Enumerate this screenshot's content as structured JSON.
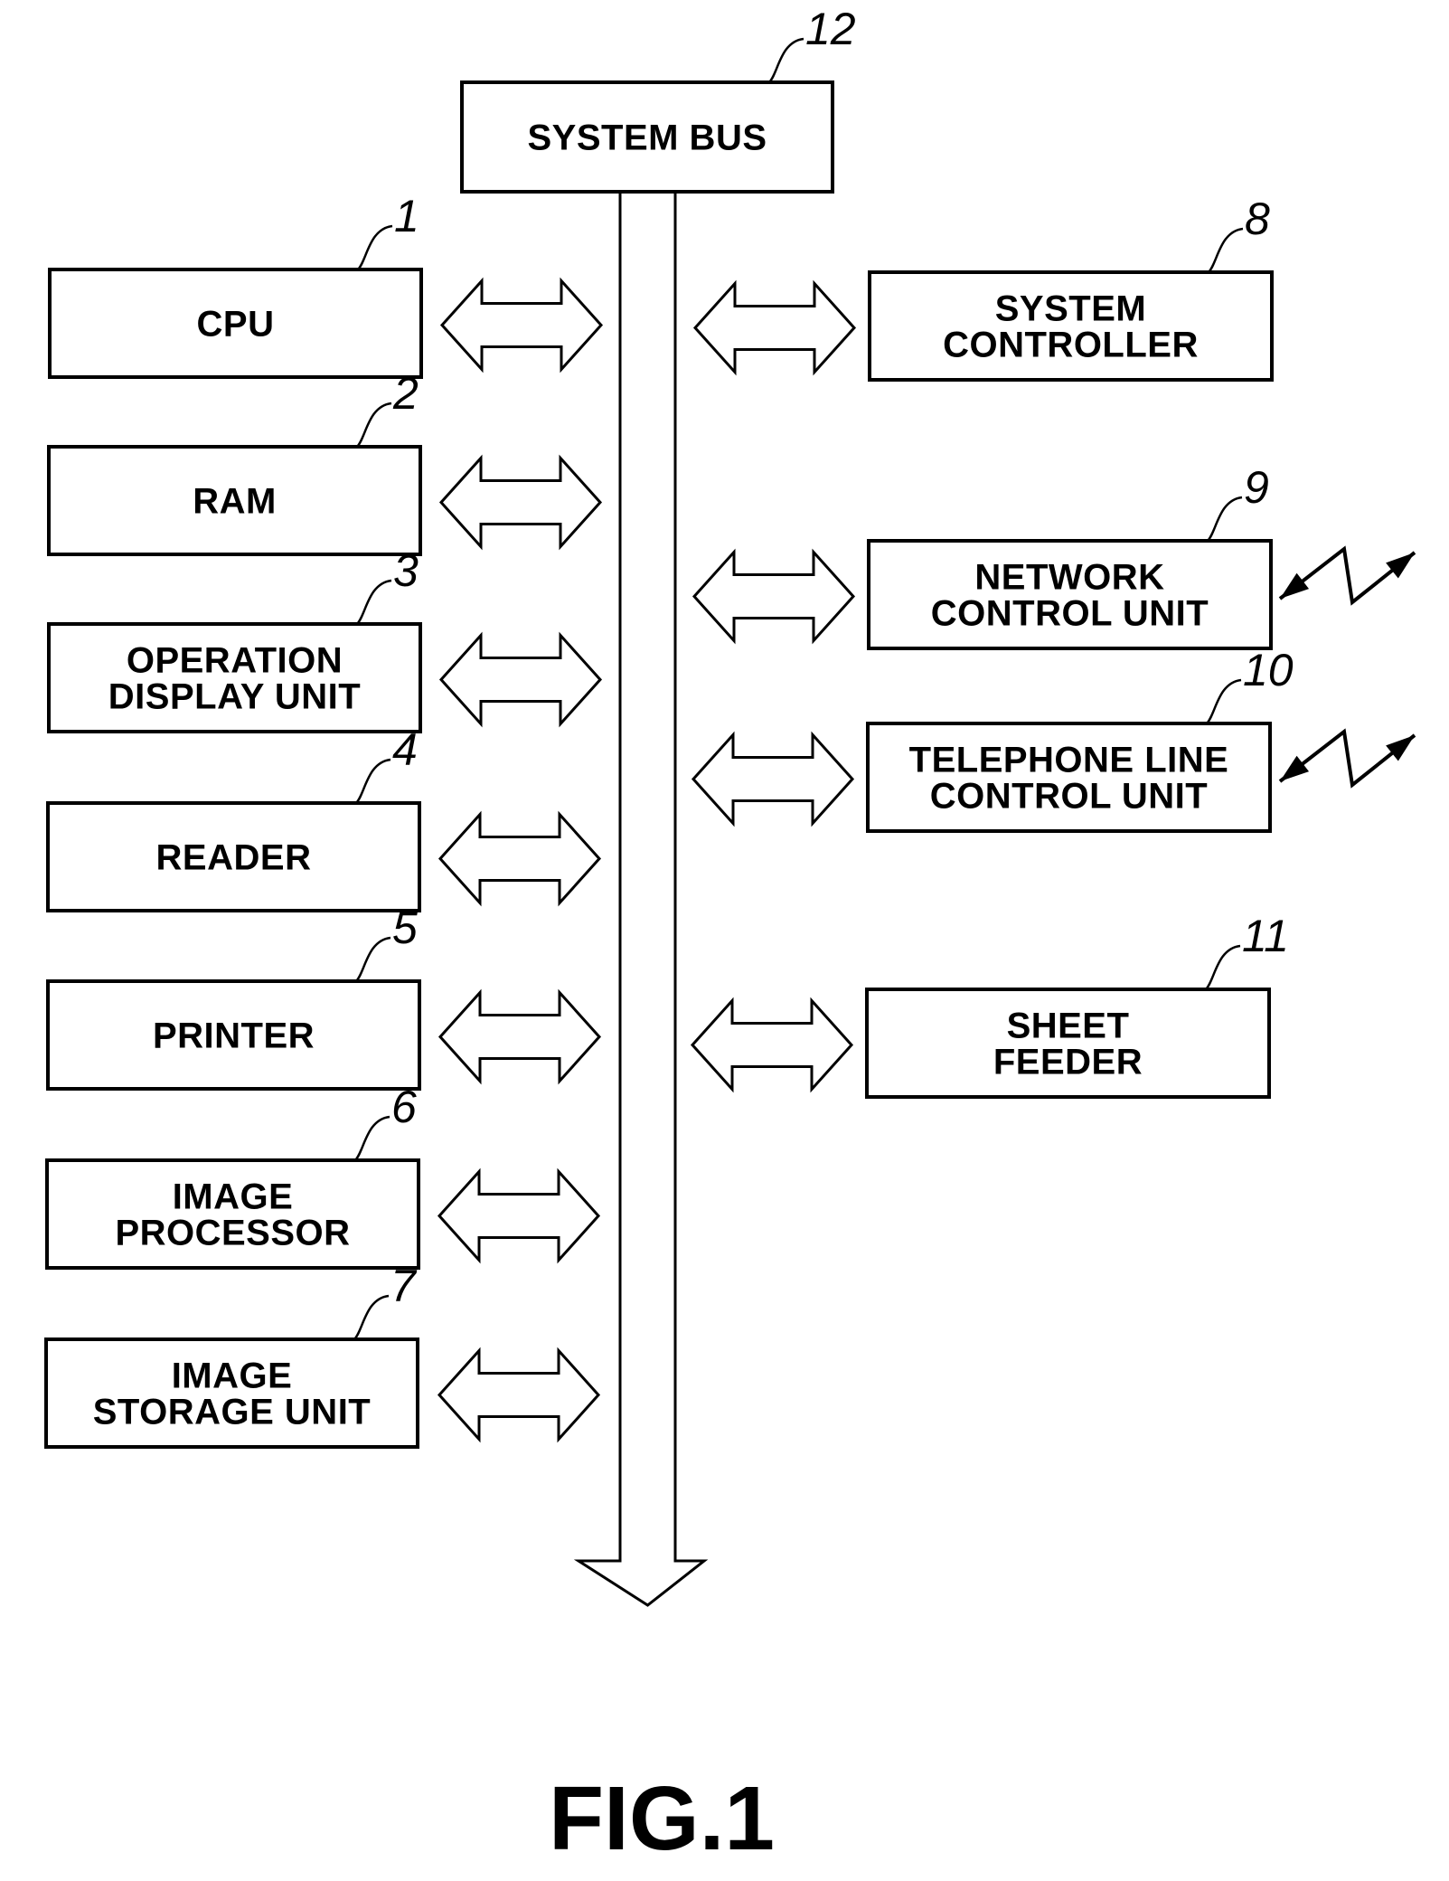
{
  "figure": {
    "label": "FIG.1",
    "system_bus": {
      "ref": "12",
      "lines": [
        "SYSTEM BUS"
      ]
    },
    "left_blocks": [
      {
        "ref": "1",
        "lines": [
          "CPU"
        ]
      },
      {
        "ref": "2",
        "lines": [
          "RAM"
        ]
      },
      {
        "ref": "3",
        "lines": [
          "OPERATION",
          "DISPLAY UNIT"
        ]
      },
      {
        "ref": "4",
        "lines": [
          "READER"
        ]
      },
      {
        "ref": "5",
        "lines": [
          "PRINTER"
        ]
      },
      {
        "ref": "6",
        "lines": [
          "IMAGE",
          "PROCESSOR"
        ]
      },
      {
        "ref": "7",
        "lines": [
          "IMAGE",
          "STORAGE UNIT"
        ]
      }
    ],
    "right_blocks": [
      {
        "ref": "8",
        "lines": [
          "SYSTEM",
          "CONTROLLER"
        ],
        "external_link": false
      },
      {
        "ref": "9",
        "lines": [
          "NETWORK",
          "CONTROL UNIT"
        ],
        "external_link": true
      },
      {
        "ref": "10",
        "lines": [
          "TELEPHONE LINE",
          "CONTROL UNIT"
        ],
        "external_link": true
      },
      {
        "ref": "11",
        "lines": [
          "SHEET",
          "FEEDER"
        ],
        "external_link": false
      }
    ],
    "connections": [
      {
        "from": "1",
        "to": "12",
        "type": "bidirectional"
      },
      {
        "from": "2",
        "to": "12",
        "type": "bidirectional"
      },
      {
        "from": "3",
        "to": "12",
        "type": "bidirectional"
      },
      {
        "from": "4",
        "to": "12",
        "type": "bidirectional"
      },
      {
        "from": "5",
        "to": "12",
        "type": "bidirectional"
      },
      {
        "from": "6",
        "to": "12",
        "type": "bidirectional"
      },
      {
        "from": "7",
        "to": "12",
        "type": "bidirectional"
      },
      {
        "from": "8",
        "to": "12",
        "type": "bidirectional"
      },
      {
        "from": "9",
        "to": "12",
        "type": "bidirectional"
      },
      {
        "from": "10",
        "to": "12",
        "type": "bidirectional"
      },
      {
        "from": "11",
        "to": "12",
        "type": "bidirectional"
      }
    ]
  }
}
